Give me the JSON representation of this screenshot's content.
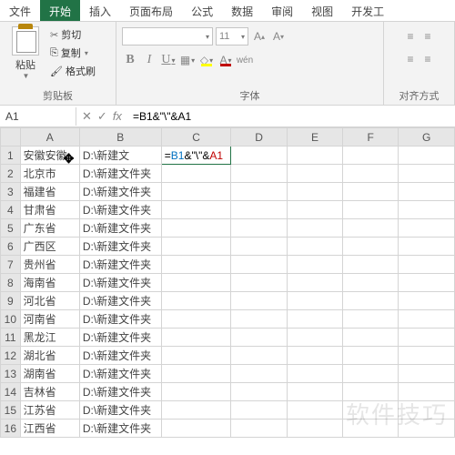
{
  "tabs": {
    "file": "文件",
    "home": "开始",
    "insert": "插入",
    "layout": "页面布局",
    "formula": "公式",
    "data": "数据",
    "review": "审阅",
    "view": "视图",
    "dev": "开发工"
  },
  "ribbon": {
    "paste": "粘贴",
    "cut": "剪切",
    "copy": "复制",
    "format_painter": "格式刷",
    "clipboard_label": "剪贴板",
    "font_label": "字体",
    "align_label": "对齐方式",
    "font_size": "11",
    "aplus": "A",
    "aminus": "A",
    "wen": "wén"
  },
  "namebox": "A1",
  "formula": "=B1&\"\\\"&A1",
  "cell_formula": {
    "pre": "=",
    "r1": "B1",
    "mid": "&\"\\\"&",
    "r2": "A1"
  },
  "cols": [
    "A",
    "B",
    "C",
    "D",
    "E",
    "F",
    "G"
  ],
  "rows": [
    {
      "n": 1,
      "a": "安徽",
      "b": "D:\\新建文"
    },
    {
      "n": 2,
      "a": "北京市",
      "b": "D:\\新建文件夹"
    },
    {
      "n": 3,
      "a": "福建省",
      "b": "D:\\新建文件夹"
    },
    {
      "n": 4,
      "a": "甘肃省",
      "b": "D:\\新建文件夹"
    },
    {
      "n": 5,
      "a": "广东省",
      "b": "D:\\新建文件夹"
    },
    {
      "n": 6,
      "a": "广西区",
      "b": "D:\\新建文件夹"
    },
    {
      "n": 7,
      "a": "贵州省",
      "b": "D:\\新建文件夹"
    },
    {
      "n": 8,
      "a": "海南省",
      "b": "D:\\新建文件夹"
    },
    {
      "n": 9,
      "a": "河北省",
      "b": "D:\\新建文件夹"
    },
    {
      "n": 10,
      "a": "河南省",
      "b": "D:\\新建文件夹"
    },
    {
      "n": 11,
      "a": "黑龙江",
      "b": "D:\\新建文件夹"
    },
    {
      "n": 12,
      "a": "湖北省",
      "b": "D:\\新建文件夹"
    },
    {
      "n": 13,
      "a": "湖南省",
      "b": "D:\\新建文件夹"
    },
    {
      "n": 14,
      "a": "吉林省",
      "b": "D:\\新建文件夹"
    },
    {
      "n": 15,
      "a": "江苏省",
      "b": "D:\\新建文件夹"
    },
    {
      "n": 16,
      "a": "江西省",
      "b": "D:\\新建文件夹"
    }
  ],
  "watermark": "软件技巧"
}
